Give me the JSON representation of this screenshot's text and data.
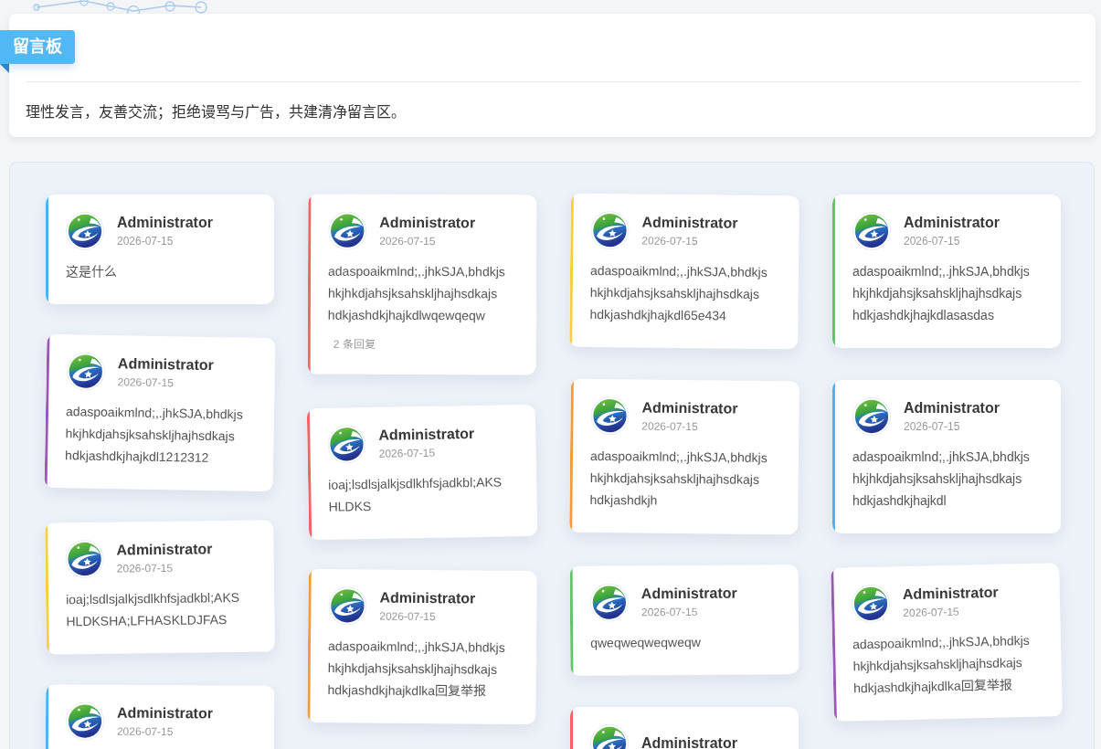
{
  "board": {
    "title": "留言板",
    "notice": "理性发言，友善交流；拒绝谩骂与广告，共建清净留言区。"
  },
  "columns": [
    {
      "messages": [
        {
          "author": "Administrator",
          "date": "2026-07-15",
          "lines": [
            "这是什么"
          ],
          "color": "#4db3f0"
        },
        {
          "author": "Administrator",
          "date": "2026-07-15",
          "lines": [
            "adaspoaikmlnd;,.jhkSJA,bhdkjs",
            "hkjhkdjahsjksahskljhajhsdkajs",
            "hdkjashdkjhajkdl1212312"
          ],
          "color": "#9b59b6"
        },
        {
          "author": "Administrator",
          "date": "2026-07-15",
          "lines": [
            "ioaj;lsdlsjalkjsdlkhfsjadkbl;AKS",
            "HLDKSHA;LFHASKLDJFAS"
          ],
          "color": "#f5d03c"
        },
        {
          "author": "Administrator",
          "date": "2026-07-15",
          "color": "#4db3f0"
        }
      ]
    },
    {
      "messages": [
        {
          "author": "Administrator",
          "date": "2026-07-15",
          "lines": [
            "adaspoaikmlnd;,.jhkSJA,bhdkjs",
            "hkjhkdjahsjksahskljhajhsdkajs",
            "hdkjashdkjhajkdlwqewqeqw"
          ],
          "replies": "2 条回复",
          "color": "#ef6565"
        },
        {
          "author": "Administrator",
          "date": "2026-07-15",
          "lines": [
            "ioaj;lsdlsjalkjsdlkhfsjadkbl;AKS",
            "HLDKS"
          ],
          "color": "#ef6565"
        },
        {
          "author": "Administrator",
          "date": "2026-07-15",
          "lines": [
            "adaspoaikmlnd;,.jhkSJA,bhdkjs",
            "hkjhkdjahsjksahskljhajhsdkajs",
            "hdkjashdkjhajkdlka回复举报"
          ],
          "color": "#f39a3a"
        }
      ]
    },
    {
      "messages": [
        {
          "author": "Administrator",
          "date": "2026-07-15",
          "lines": [
            "adaspoaikmlnd;,.jhkSJA,bhdkjs",
            "hkjhkdjahsjksahskljhajhsdkajs",
            "hdkjashdkjhajkdl65e434"
          ],
          "color": "#f5d03c"
        },
        {
          "author": "Administrator",
          "date": "2026-07-15",
          "lines": [
            "adaspoaikmlnd;,.jhkSJA,bhdkjs",
            "hkjhkdjahsjksahskljhajhsdkajs",
            "hdkjashdkjh"
          ],
          "color": "#f39a3a"
        },
        {
          "author": "Administrator",
          "date": "2026-07-15",
          "lines": [
            "qweqweqweqweqw"
          ],
          "color": "#62c46a"
        },
        {
          "author": "Administrator",
          "color": "#ef6565"
        }
      ]
    },
    {
      "messages": [
        {
          "author": "Administrator",
          "date": "2026-07-15",
          "lines": [
            "adaspoaikmlnd;,.jhkSJA,bhdkjs",
            "hkjhkdjahsjksahskljhajhsdkajs",
            "hdkjashdkjhajkdlasasdas"
          ],
          "color": "#62c46a"
        },
        {
          "author": "Administrator",
          "date": "2026-07-15",
          "lines": [
            "adaspoaikmlnd;,.jhkSJA,bhdkjs",
            "hkjhkdjahsjksahskljhajhsdkajs",
            "hdkjashdkjhajkdl"
          ],
          "color": "#4db3f0"
        },
        {
          "author": "Administrator",
          "date": "2026-07-15",
          "lines": [
            "adaspoaikmlnd;,.jhkSJA,bhdkjs",
            "hkjhkdjahsjksahskljhajhsdkajs",
            "hdkjashdkjhajkdlka回复举报"
          ],
          "color": "#9b59b6"
        }
      ]
    }
  ]
}
